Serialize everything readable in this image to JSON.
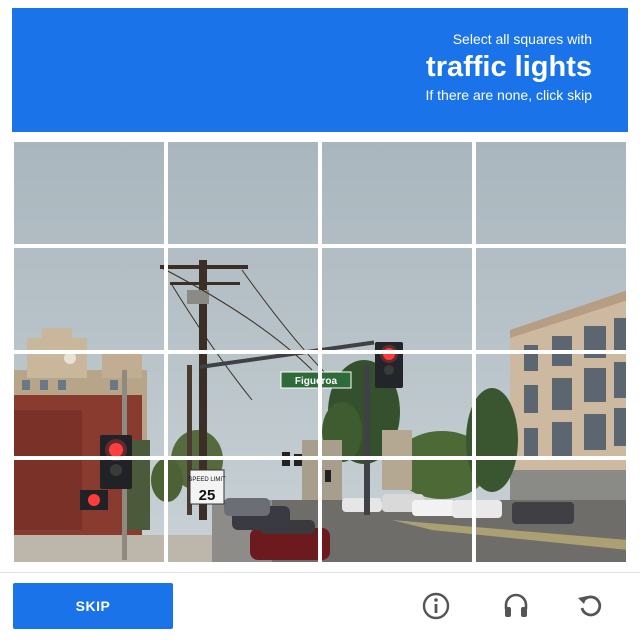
{
  "header": {
    "instruction_pre": "Select all squares with",
    "target": "traffic lights",
    "instruction_post": "If there are none, click skip",
    "color": "#1a73e8"
  },
  "scene": {
    "street_sign": "Figueroa",
    "speed_sign_top": "SPEED LIMIT",
    "speed_sign_value": "25"
  },
  "grid": {
    "rows": 4,
    "cols": 4
  },
  "footer": {
    "skip_label": "SKIP",
    "icons": [
      "reload-icon",
      "audio-icon",
      "info-icon"
    ]
  }
}
